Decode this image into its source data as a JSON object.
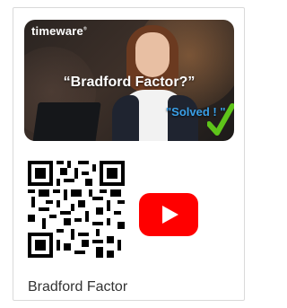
{
  "video": {
    "brand": "timeware",
    "brand_mark": "®",
    "headline": "“Bradford Factor?”",
    "badge": "\"Solved ! \""
  },
  "play_icon": "youtube-play-icon",
  "qr_icon": "qr-code-icon",
  "check_icon": "checkmark-icon",
  "caption": "Bradford Factor",
  "colors": {
    "youtube_red": "#ff0000",
    "badge_blue": "#3aa0e8",
    "check_green": "#5ec41a",
    "caption_text": "#333333"
  }
}
